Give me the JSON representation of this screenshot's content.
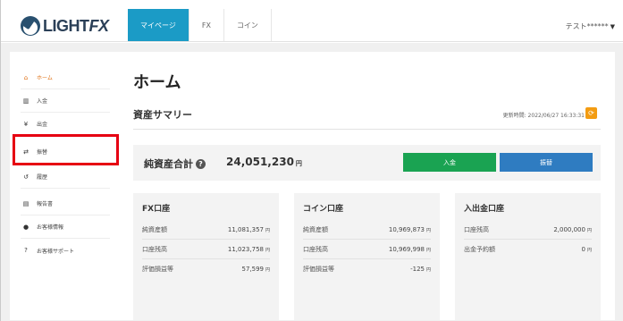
{
  "header": {
    "logo_text": "LIGHT",
    "logo_fx": "FX",
    "tabs": [
      {
        "label": "マイページ",
        "active": true
      },
      {
        "label": "FX",
        "active": false
      },
      {
        "label": "コイン",
        "active": false
      }
    ],
    "user_name": "テスト******"
  },
  "sidebar": {
    "items": [
      {
        "icon": "home-icon",
        "glyph": "⌂",
        "label": "ホーム",
        "active": true
      },
      {
        "icon": "bank-icon",
        "glyph": "⌂",
        "label": "入金"
      },
      {
        "icon": "yen-icon",
        "glyph": "¥",
        "label": "出金"
      },
      {
        "icon": "transfer-icon",
        "glyph": "⇄",
        "label": "振替"
      },
      {
        "icon": "history-icon",
        "glyph": "↺",
        "label": "履歴"
      },
      {
        "icon": "report-icon",
        "glyph": "▤",
        "label": "報告書"
      },
      {
        "icon": "user-icon",
        "glyph": "●",
        "label": "お客様情報"
      },
      {
        "icon": "help-icon",
        "glyph": "?",
        "label": "お客様サポート"
      }
    ]
  },
  "main": {
    "title": "ホーム",
    "section_title": "資産サマリー",
    "updated": "更新時間: 2022/06/27 16:33:31",
    "total": {
      "label": "純資産合計",
      "value": "24,051,230",
      "unit": "円",
      "deposit_label": "入金",
      "transfer_label": "振替"
    },
    "cards": [
      {
        "title": "FX口座",
        "rows": [
          {
            "label": "純資産額",
            "value": "11,081,357",
            "unit": "円"
          },
          {
            "label": "口座残高",
            "value": "11,023,758",
            "unit": "円"
          },
          {
            "label": "評価損益等",
            "value": "57,599",
            "unit": "円"
          }
        ]
      },
      {
        "title": "コイン口座",
        "rows": [
          {
            "label": "純資産額",
            "value": "10,969,873",
            "unit": "円"
          },
          {
            "label": "口座残高",
            "value": "10,969,998",
            "unit": "円"
          },
          {
            "label": "評価損益等",
            "value": "-125",
            "unit": "円"
          }
        ]
      },
      {
        "title": "入出金口座",
        "rows": [
          {
            "label": "口座残高",
            "value": "2,000,000",
            "unit": "円"
          },
          {
            "label": "出金予約額",
            "value": "0",
            "unit": "円"
          }
        ]
      }
    ]
  },
  "colors": {
    "accent": "#1b9bc6",
    "active_menu": "#e0741b",
    "deposit": "#1aa352",
    "transfer": "#2f7cc1",
    "highlight": "#e60012"
  }
}
